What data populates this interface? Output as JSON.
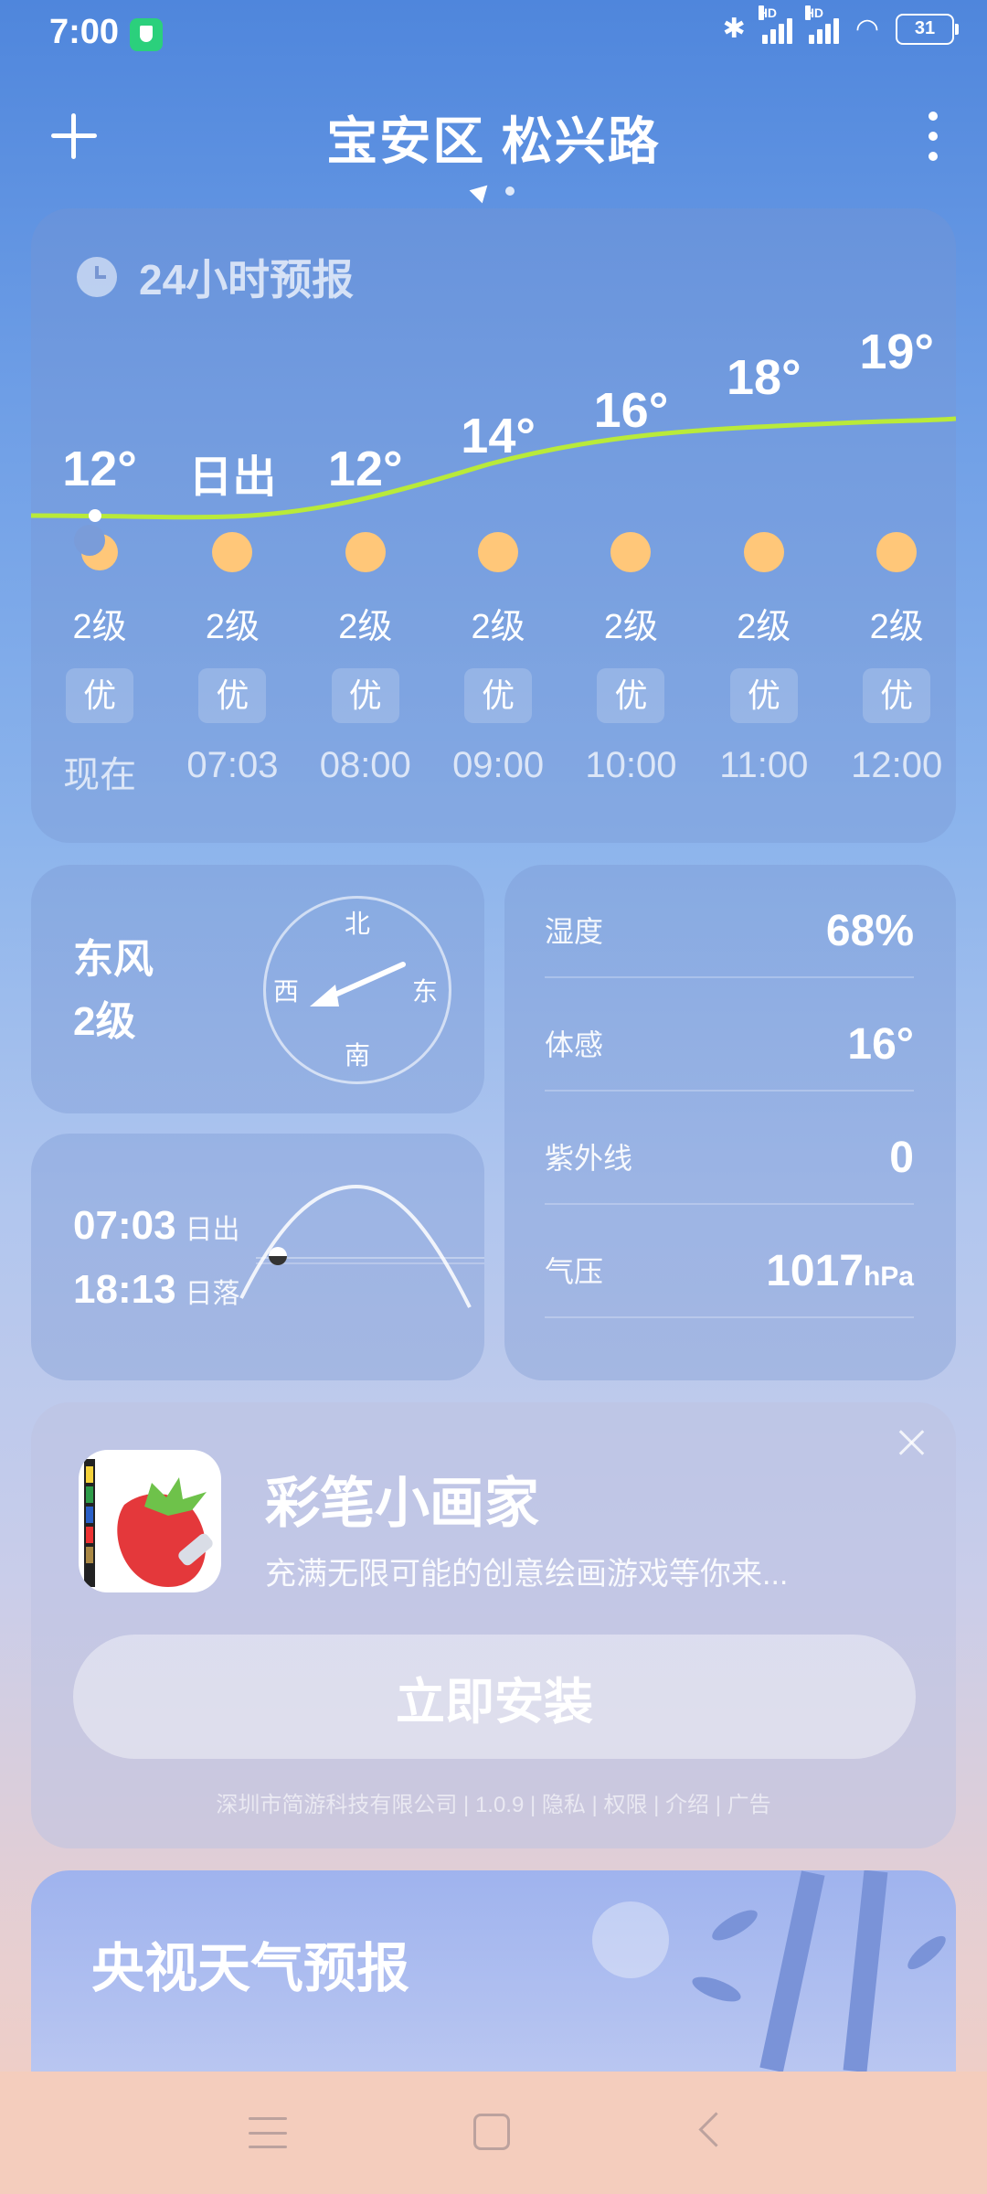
{
  "status": {
    "time": "7:00",
    "battery": "31",
    "hd_label": "HD"
  },
  "header": {
    "city": "宝安区 松兴路"
  },
  "hourly": {
    "title": "24小时预报",
    "items": [
      {
        "temp": "12°",
        "icon": "moon-icon",
        "level": "2级",
        "aq": "优",
        "time": "现在"
      },
      {
        "temp": "日出",
        "icon": "sun-icon",
        "level": "2级",
        "aq": "优",
        "time": "07:03"
      },
      {
        "temp": "12°",
        "icon": "sun-icon",
        "level": "2级",
        "aq": "优",
        "time": "08:00"
      },
      {
        "temp": "14°",
        "icon": "sun-icon",
        "level": "2级",
        "aq": "优",
        "time": "09:00"
      },
      {
        "temp": "16°",
        "icon": "sun-icon",
        "level": "2级",
        "aq": "优",
        "time": "10:00"
      },
      {
        "temp": "18°",
        "icon": "sun-icon",
        "level": "2级",
        "aq": "优",
        "time": "11:00"
      },
      {
        "temp": "19°",
        "icon": "sun-icon",
        "level": "2级",
        "aq": "优",
        "time": "12:00"
      }
    ]
  },
  "wind": {
    "direction": "东风",
    "level": "2级",
    "north": "北",
    "south": "南",
    "west": "西",
    "east": "东"
  },
  "sun": {
    "rise_time": "07:03",
    "rise_label": "日出",
    "set_time": "18:13",
    "set_label": "日落"
  },
  "info": {
    "rows": [
      {
        "label": "湿度",
        "value": "68%",
        "unit": ""
      },
      {
        "label": "体感",
        "value": "16°",
        "unit": ""
      },
      {
        "label": "紫外线",
        "value": "0",
        "unit": ""
      },
      {
        "label": "气压",
        "value": "1017",
        "unit": "hPa"
      }
    ]
  },
  "ad": {
    "title": "彩笔小画家",
    "desc": "充满无限可能的创意绘画游戏等你来...",
    "button": "立即安装",
    "meta": "深圳市简游科技有限公司 | 1.0.9 | 隐私 | 权限 | 介绍 | 广告"
  },
  "cctv": {
    "title": "央视天气预报"
  },
  "colors": {
    "line": "#b9ea3a",
    "sun": "#ffc779",
    "accent_green": "#2bd07c"
  }
}
